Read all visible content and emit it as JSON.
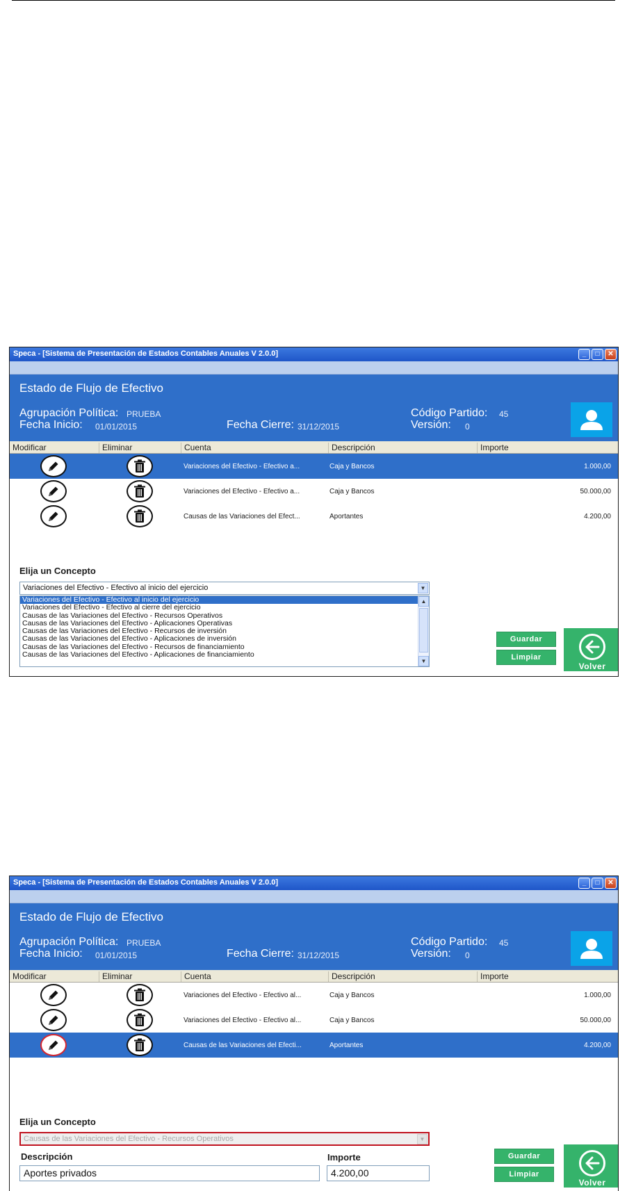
{
  "window": {
    "title": "Speca - [Sistema de Presentación de Estados Contables Anuales V 2.0.0]",
    "minimize_glyph": "_",
    "maximize_glyph": "□",
    "close_glyph": "✕"
  },
  "header": {
    "form_title": "Estado de Flujo de Efectivo",
    "agrupacion_label": "Agrupación Política:",
    "agrupacion_value": "PRUEBA",
    "fecha_inicio_label": "Fecha Inicio:",
    "fecha_inicio_value": "01/01/2015",
    "fecha_cierre_label": "Fecha Cierre:",
    "fecha_cierre_value": "31/12/2015",
    "codigo_label": "Código Partido:",
    "codigo_value": "45",
    "version_label": "Versión:",
    "version_value": "0",
    "avatar_icon": "user-icon"
  },
  "columns": [
    "Modificar",
    "Eliminar",
    "Cuenta",
    "Descripción",
    "Importe"
  ],
  "screen1": {
    "rows": [
      {
        "cuenta": "Variaciones del Efectivo - Efectivo a...",
        "descripcion": "Caja y Bancos",
        "importe": "1.000,00"
      },
      {
        "cuenta": "Variaciones del Efectivo - Efectivo a...",
        "descripcion": "Caja y Bancos",
        "importe": "50.000,00"
      },
      {
        "cuenta": "Causas de las Variaciones del Efect...",
        "descripcion": "Aportantes",
        "importe": "4.200,00"
      }
    ],
    "concepto_label": "Elija un Concepto",
    "concepto_selected": "Variaciones del Efectivo - Efectivo al inicio del ejercicio",
    "options": [
      "Variaciones del Efectivo - Efectivo al inicio del ejercicio",
      "Variaciones del Efectivo - Efectivo al cierre del ejercicio",
      "Causas de las Variaciones del Efectivo - Recursos Operativos",
      "Causas de las Variaciones del Efectivo - Aplicaciones Operativas",
      "Causas de las Variaciones del Efectivo - Recursos de inversión",
      "Causas de las Variaciones del Efectivo - Aplicaciones de inversión",
      "Causas de las Variaciones del Efectivo - Recursos de financiamiento",
      "Causas de las Variaciones del Efectivo - Aplicaciones de financiamiento"
    ],
    "guardar_label": "Guardar",
    "limpiar_label": "Limpiar",
    "volver_label": "Volver"
  },
  "screen2": {
    "rows": [
      {
        "cuenta": "Variaciones del Efectivo - Efectivo al...",
        "descripcion": "Caja y Bancos",
        "importe": "1.000,00"
      },
      {
        "cuenta": "Variaciones del Efectivo - Efectivo al...",
        "descripcion": "Caja y Bancos",
        "importe": "50.000,00"
      },
      {
        "cuenta": "Causas de las Variaciones del Efecti...",
        "descripcion": "Aportantes",
        "importe": "4.200,00"
      }
    ],
    "concepto_label": "Elija un Concepto",
    "concepto_selected": "Causas de las Variaciones del Efectivo - Recursos Operativos",
    "descripcion_label": "Descripción",
    "descripcion_value": "Aportes privados",
    "importe_label": "Importe",
    "importe_value": "4.200,00",
    "guardar_label": "Guardar",
    "limpiar_label": "Limpiar",
    "volver_label": "Volver"
  },
  "colors": {
    "header_blue": "#2f6fc9",
    "selection_blue": "#2f6fc9",
    "button_green": "#35b36b",
    "avatar_blue": "#0aa3e8",
    "highlight_red": "#d8262e"
  }
}
